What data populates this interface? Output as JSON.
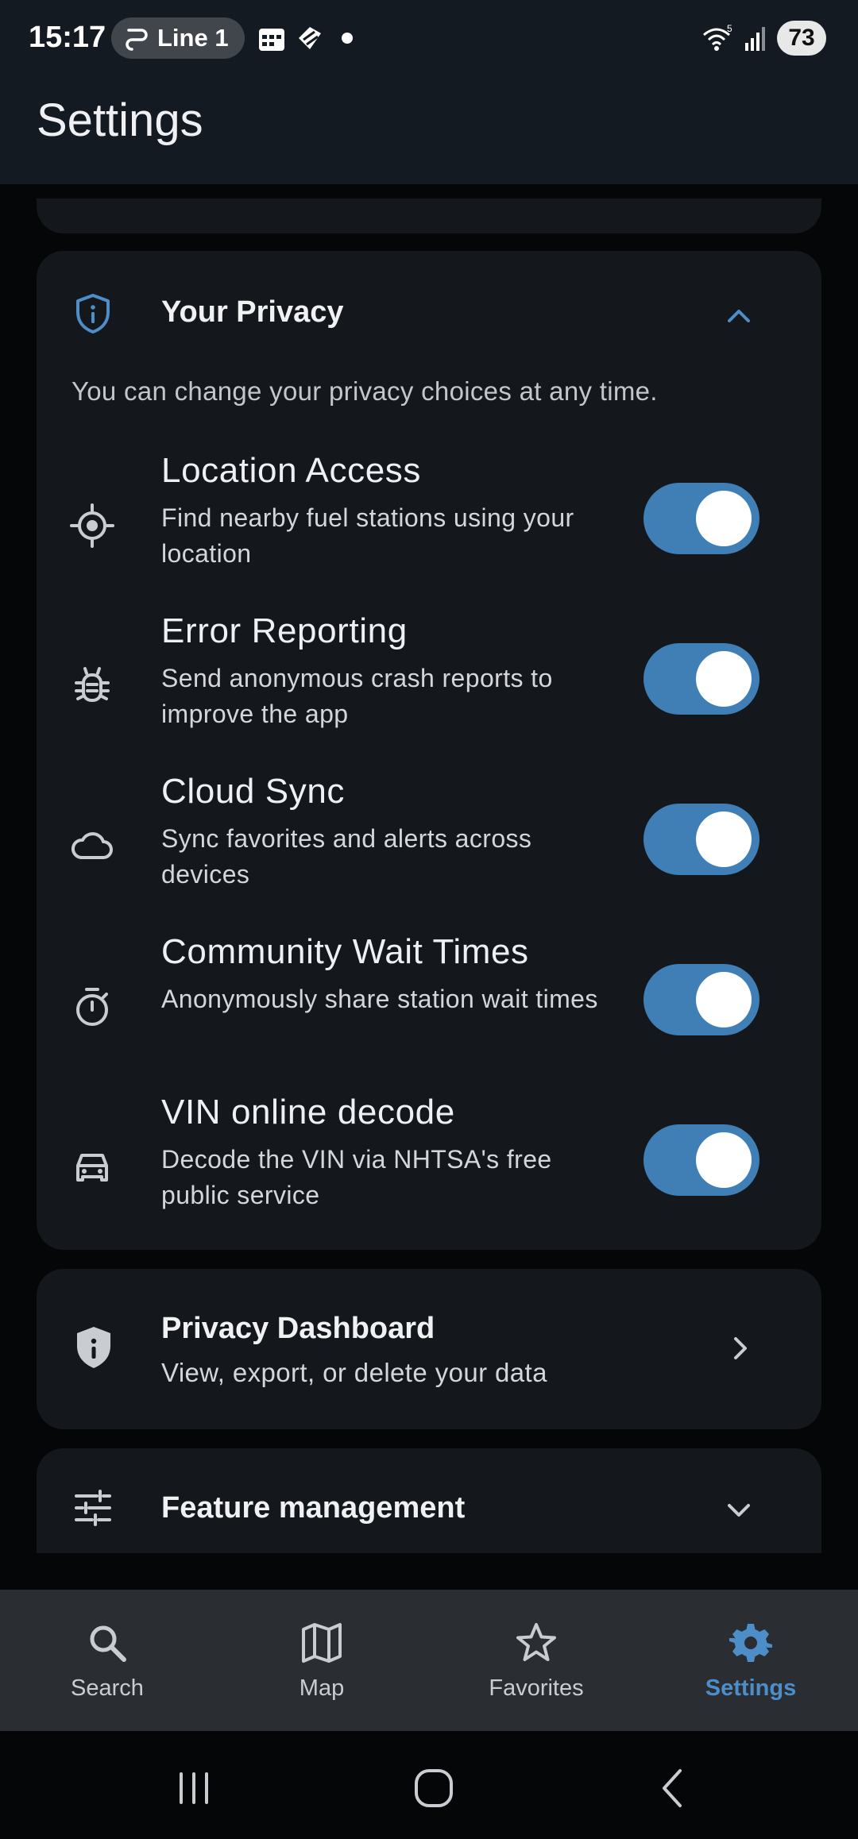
{
  "status_bar": {
    "time": "15:17",
    "pill_text": "Line 1",
    "battery": "73",
    "wifi_label": "5"
  },
  "app_bar": {
    "title": "Settings"
  },
  "privacy": {
    "title": "Your Privacy",
    "description": "You can change your privacy choices at any time.",
    "items": [
      {
        "icon": "location-icon",
        "title": "Location Access",
        "subtitle": "Find nearby fuel stations using your location",
        "enabled": true
      },
      {
        "icon": "bug-icon",
        "title": "Error Reporting",
        "subtitle": "Send anonymous crash reports to improve the app",
        "enabled": true
      },
      {
        "icon": "cloud-icon",
        "title": "Cloud Sync",
        "subtitle": "Sync favorites and alerts across devices",
        "enabled": true
      },
      {
        "icon": "timer-icon",
        "title": "Community Wait Times",
        "subtitle": "Anonymously share station wait times",
        "enabled": true
      },
      {
        "icon": "car-icon",
        "title": "VIN online decode",
        "subtitle": "Decode the VIN via NHTSA's free public service",
        "enabled": true
      }
    ]
  },
  "dashboard": {
    "title": "Privacy Dashboard",
    "subtitle": "View, export, or delete your data"
  },
  "feature_management": {
    "title": "Feature management"
  },
  "bottom_nav": {
    "items": [
      {
        "label": "Search",
        "icon": "search-icon"
      },
      {
        "label": "Map",
        "icon": "map-icon"
      },
      {
        "label": "Favorites",
        "icon": "star-icon"
      },
      {
        "label": "Settings",
        "icon": "gear-icon",
        "active": true
      }
    ]
  },
  "colors": {
    "accent": "#3f7fb6",
    "active_nav": "#4d8ec9",
    "card": "#14171c",
    "background": "#050607"
  }
}
